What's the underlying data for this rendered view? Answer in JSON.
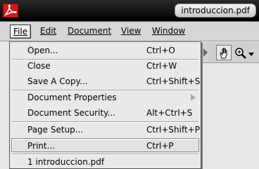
{
  "window": {
    "title": "introduccion.pdf",
    "app_icon": "acrobat-reader-icon"
  },
  "menubar": [
    {
      "key": "file",
      "label": "File"
    },
    {
      "key": "edit",
      "label": "Edit"
    },
    {
      "key": "document",
      "label": "Document"
    },
    {
      "key": "view",
      "label": "View"
    },
    {
      "key": "window",
      "label": "Window"
    }
  ],
  "toolbar": {
    "icons": [
      "hand-tool-icon",
      "zoom-in-icon",
      "dropdown-arrow-icon"
    ]
  },
  "file_menu": {
    "open": {
      "label": "Open...",
      "shortcut": "Ctrl+O"
    },
    "close": {
      "label": "Close",
      "shortcut": "Ctrl+W"
    },
    "save_copy": {
      "label": "Save A Copy...",
      "shortcut": "Ctrl+Shift+S"
    },
    "doc_props": {
      "label": "Document Properties",
      "submenu": true
    },
    "doc_security": {
      "label": "Document Security...",
      "shortcut": "Alt+Ctrl+S"
    },
    "page_setup": {
      "label": "Page Setup...",
      "shortcut": "Ctrl+Shift+P"
    },
    "print": {
      "label": "Print...",
      "shortcut": "Ctrl+P"
    },
    "recent_1": {
      "label": "1 introduccion.pdf"
    }
  }
}
